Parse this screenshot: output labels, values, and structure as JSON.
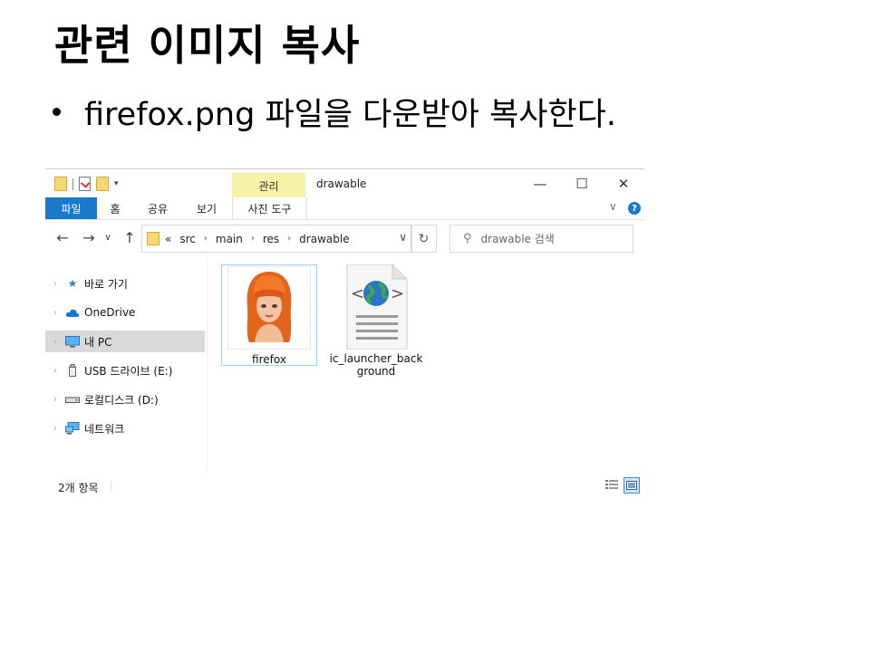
{
  "slide": {
    "title": "관련 이미지 복사",
    "bullet": "firefox.png 파일을 다운받아 복사한다."
  },
  "window": {
    "title": "drawable",
    "manage_tab": "관리",
    "controls": {
      "minimize": "—",
      "maximize": "☐",
      "close": "✕"
    }
  },
  "ribbon": {
    "tabs": [
      {
        "label": "파일"
      },
      {
        "label": "홈"
      },
      {
        "label": "공유"
      },
      {
        "label": "보기"
      },
      {
        "label": "사진 도구"
      }
    ],
    "help": "?",
    "collapse": "∨"
  },
  "nav": {
    "back": "←",
    "forward": "→",
    "recent": "∨",
    "up": "↑",
    "address": {
      "prefix": "«",
      "crumbs": [
        "src",
        "main",
        "res",
        "drawable"
      ]
    },
    "refresh": "↻",
    "search_placeholder": "drawable 검색"
  },
  "sidebar": {
    "items": [
      {
        "label": "바로 가기",
        "icon": "star-pin-icon"
      },
      {
        "label": "OneDrive",
        "icon": "cloud-icon"
      },
      {
        "label": "내 PC",
        "icon": "monitor-icon"
      },
      {
        "label": "USB 드라이브 (E:)",
        "icon": "usb-drive-icon"
      },
      {
        "label": "로컬디스크 (D:)",
        "icon": "disk-drive-icon"
      },
      {
        "label": "네트워크",
        "icon": "network-icon"
      }
    ]
  },
  "files": [
    {
      "name": "firefox",
      "type": "image"
    },
    {
      "name": "ic_launcher_back ground",
      "type": "xml"
    }
  ],
  "status": {
    "count": "2개 항목"
  },
  "colors": {
    "accent": "#1979ca",
    "manage_tab": "#f6f3a8",
    "selection": "#d9d9d9",
    "folder": "#f8d775"
  }
}
